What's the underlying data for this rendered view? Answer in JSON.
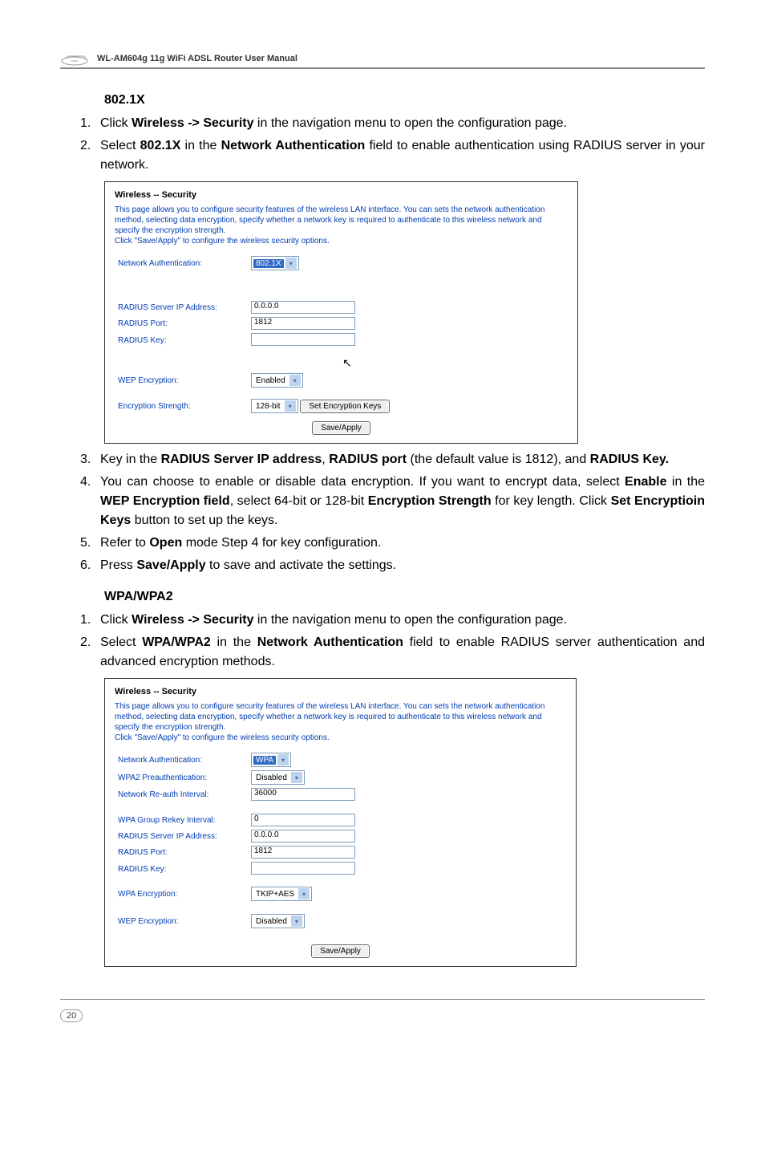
{
  "header": {
    "productTitle": "WL-AM604g 11g WiFi ADSL Router User Manual"
  },
  "sec8021x": {
    "heading": "802.1X",
    "step1": {
      "pre": "Click ",
      "b1": "Wireless -> Security",
      "post": " in the navigation menu to open the configuration page."
    },
    "step2": {
      "pre": "Select ",
      "b1": "802.1X",
      "mid": " in the ",
      "b2": "Network Authentication",
      "post": " field to enable authentication using RADIUS server in your network."
    },
    "step3": {
      "pre": "Key in the ",
      "b1": "RADIUS Server IP address",
      "mid": ", ",
      "b2": "RADIUS port",
      "post1": " (the default value is 1812), and ",
      "b3": "RADIUS Key."
    },
    "step4": {
      "pre": "You can choose to enable or disable data encryption. If you want to encrypt data, select ",
      "b1": "Enable",
      "mid1": " in the ",
      "b2": "WEP Encryption field",
      "mid2": ", select 64-bit or 128-bit ",
      "b3": "Encryption Strength",
      "mid3": " for key length. Click ",
      "b4": "Set Encryptioin Keys",
      "post": " button to set up the keys."
    },
    "step5": {
      "pre": "Refer to ",
      "b1": "Open",
      "post": " mode Step 4 for key configuration."
    },
    "step6": {
      "pre": "Press ",
      "b1": "Save/Apply",
      "post": " to save and activate the settings."
    }
  },
  "shot1": {
    "title": "Wireless -- Security",
    "desc": "This page allows you to configure security features of the wireless LAN interface. You can sets the network authentication method, selecting data encryption, specify whether a network key is required to authenticate to this wireless network and specify the encryption strength.\nClick \"Save/Apply\" to configure the wireless security options.",
    "rows": {
      "netauth": {
        "label": "Network Authentication:",
        "value": "802.1X"
      },
      "radip": {
        "label": "RADIUS Server IP Address:",
        "value": "0.0.0.0"
      },
      "radport": {
        "label": "RADIUS Port:",
        "value": "1812"
      },
      "radkey": {
        "label": "RADIUS Key:",
        "value": ""
      },
      "wepenc": {
        "label": "WEP Encryption:",
        "value": "Enabled"
      },
      "encstr": {
        "label": "Encryption Strength:",
        "value": "128-bit"
      }
    },
    "buttons": {
      "setkeys": "Set Encryption Keys",
      "save": "Save/Apply"
    }
  },
  "secWpa": {
    "heading": "WPA/WPA2",
    "step1": {
      "pre": "Click ",
      "b1": "Wireless -> Security",
      "post": " in the navigation menu to open the configuration page."
    },
    "step2": {
      "pre": "Select ",
      "b1": "WPA/WPA2",
      "mid": " in the ",
      "b2": "Network Authentication",
      "post": " field to enable RADIUS server authentication and advanced encryption methods."
    }
  },
  "shot2": {
    "title": "Wireless -- Security",
    "desc": "This page allows you to configure security features of the wireless LAN interface. You can sets the network authentication method, selecting data encryption, specify whether a network key is required to authenticate to this wireless network and specify the encryption strength.\nClick \"Save/Apply\" to configure the wireless security options.",
    "rows": {
      "netauth": {
        "label": "Network Authentication:",
        "value": "WPA"
      },
      "wpa2pre": {
        "label": "WPA2 Preauthentication:",
        "value": "Disabled"
      },
      "reauth": {
        "label": "Network Re-auth Interval:",
        "value": "36000"
      },
      "grprekey": {
        "label": "WPA Group Rekey Interval:",
        "value": "0"
      },
      "radip": {
        "label": "RADIUS Server IP Address:",
        "value": "0.0.0.0"
      },
      "radport": {
        "label": "RADIUS Port:",
        "value": "1812"
      },
      "radkey": {
        "label": "RADIUS Key:",
        "value": ""
      },
      "wpaenc": {
        "label": "WPA Encryption:",
        "value": "TKIP+AES"
      },
      "wepenc": {
        "label": "WEP Encryption:",
        "value": "Disabled"
      }
    },
    "buttons": {
      "save": "Save/Apply"
    }
  },
  "footer": {
    "pageNumber": "20"
  }
}
